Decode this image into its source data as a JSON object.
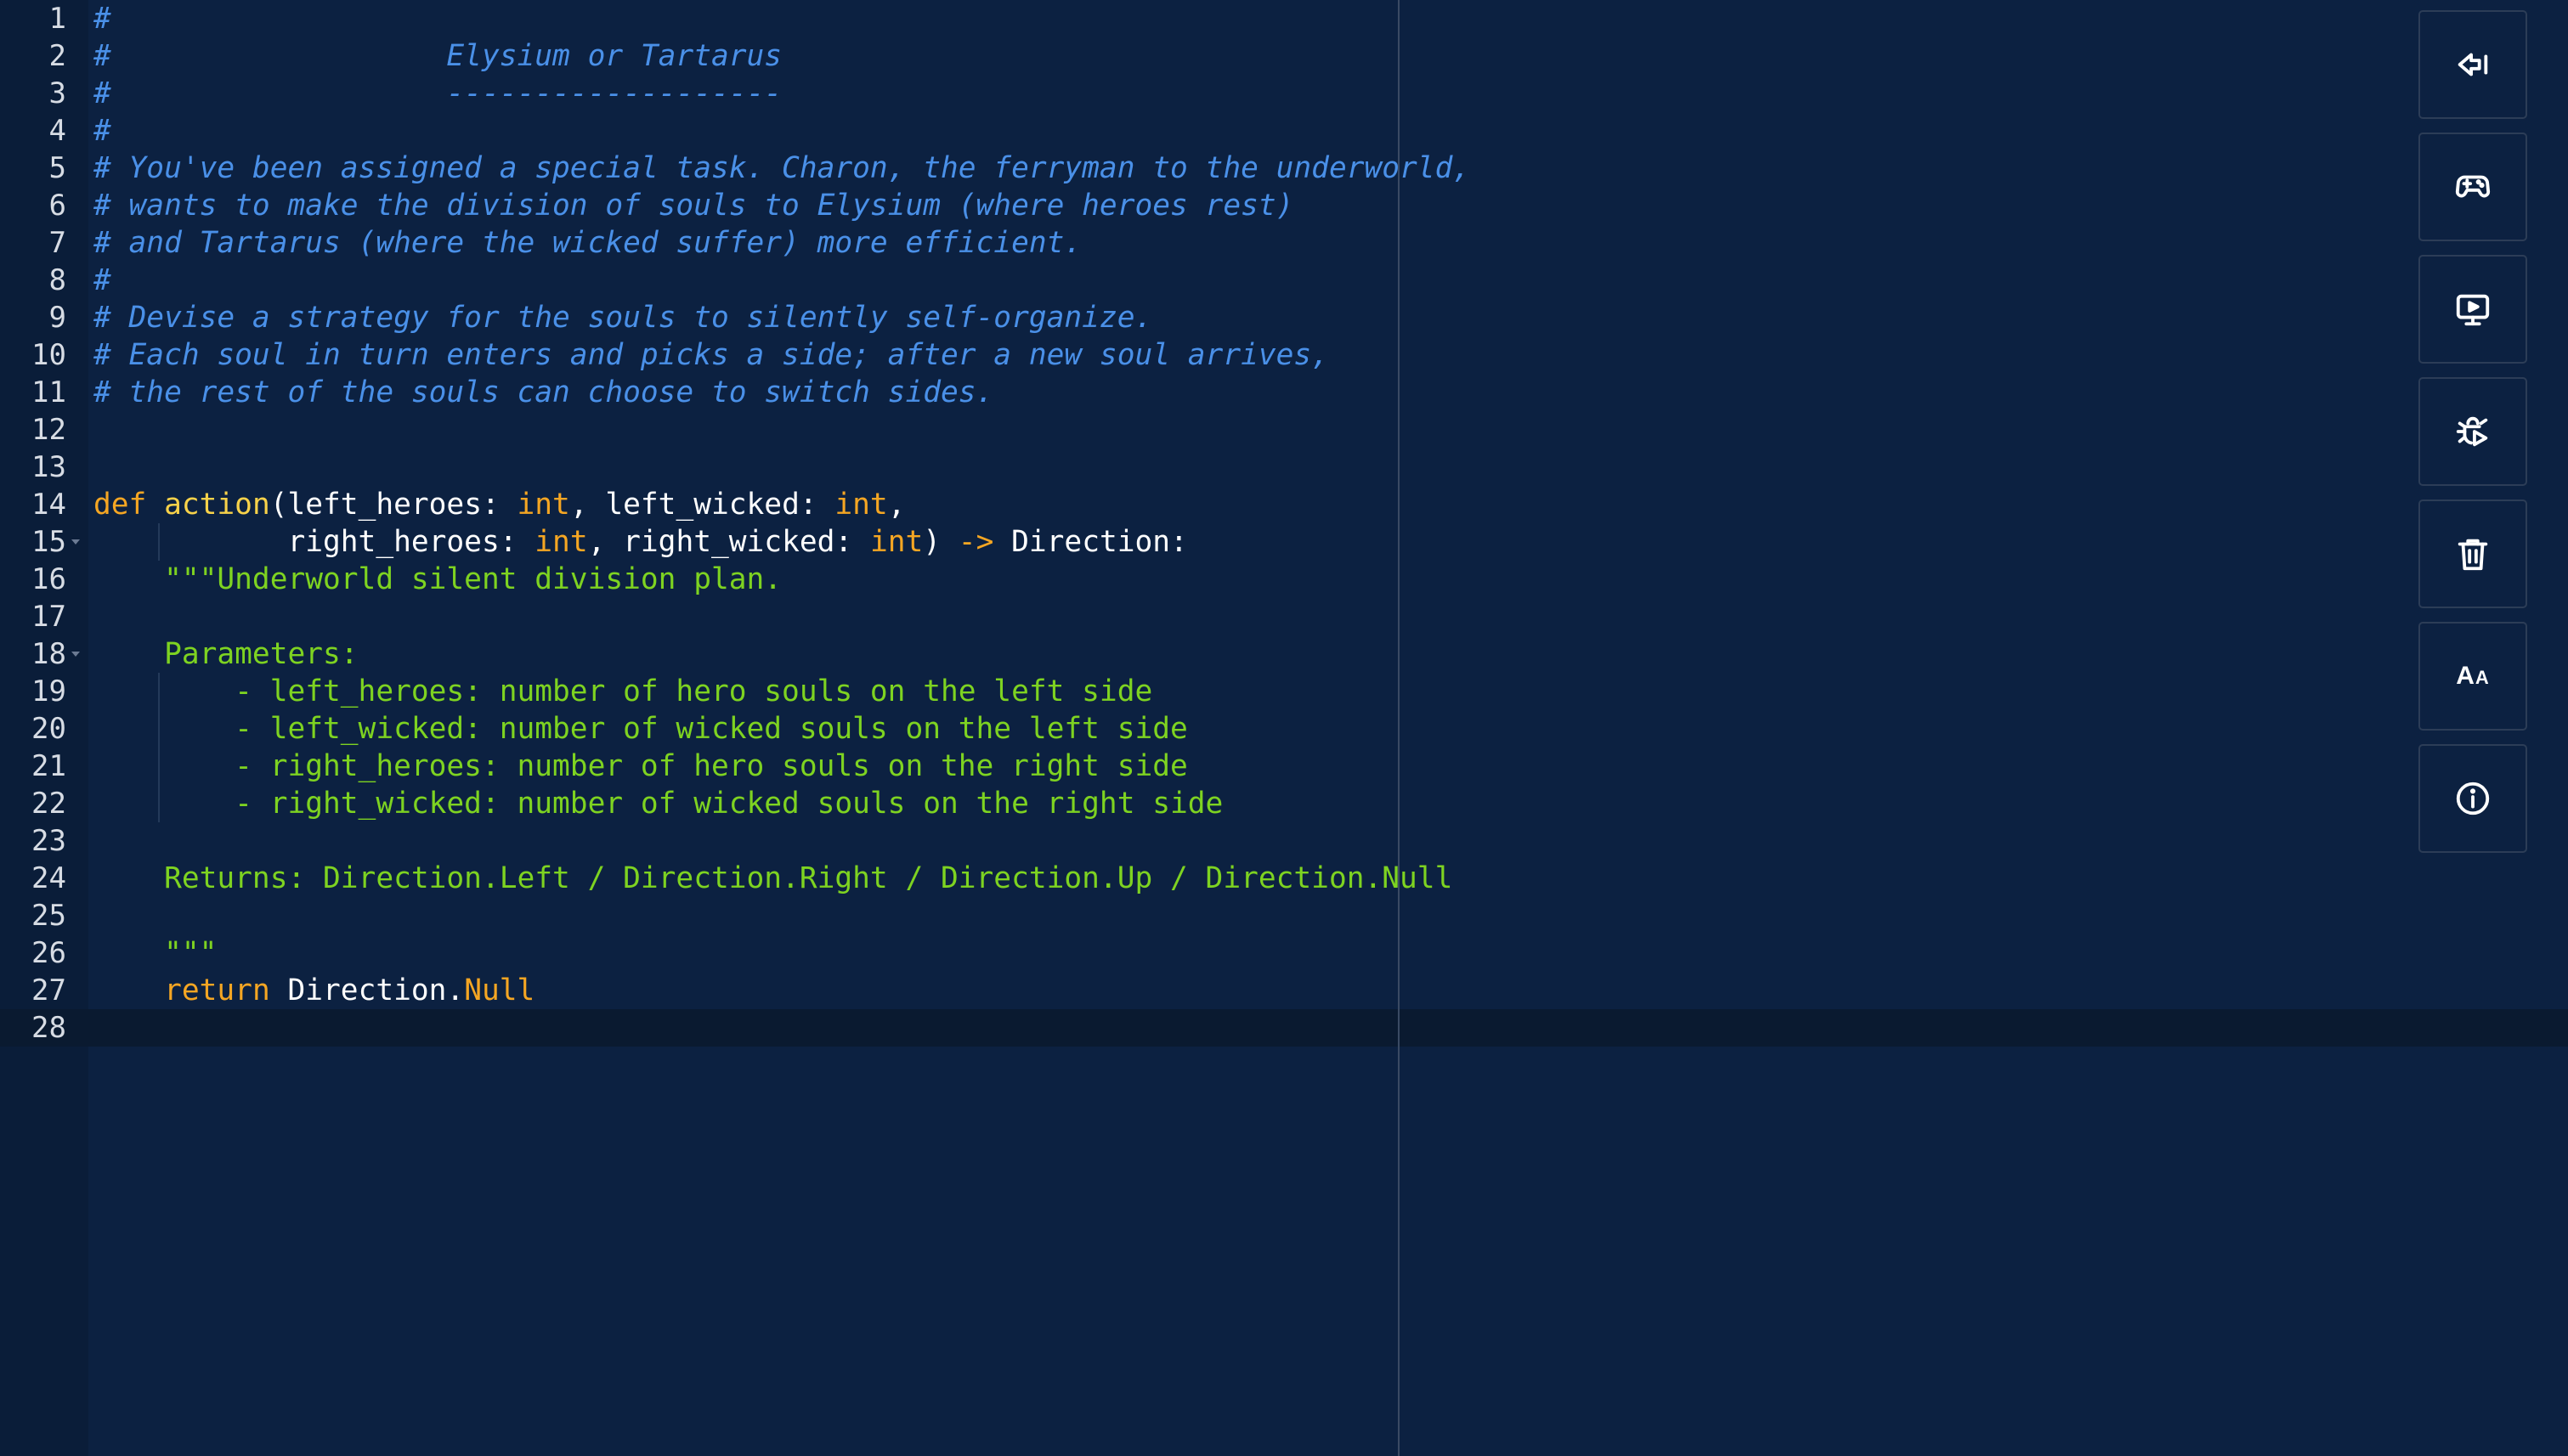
{
  "editor": {
    "lines": [
      {
        "n": "1",
        "tokens": [
          {
            "t": "#",
            "c": "comment"
          }
        ]
      },
      {
        "n": "2",
        "tokens": [
          {
            "t": "#                   Elysium or Tartarus",
            "c": "comment"
          }
        ]
      },
      {
        "n": "3",
        "tokens": [
          {
            "t": "#                   -------------------",
            "c": "comment"
          }
        ]
      },
      {
        "n": "4",
        "tokens": [
          {
            "t": "#",
            "c": "comment"
          }
        ]
      },
      {
        "n": "5",
        "tokens": [
          {
            "t": "# You've been assigned a special task. Charon, the ferryman to the underworld,",
            "c": "comment"
          }
        ]
      },
      {
        "n": "6",
        "tokens": [
          {
            "t": "# wants to make the division of souls to Elysium (where heroes rest)",
            "c": "comment"
          }
        ]
      },
      {
        "n": "7",
        "tokens": [
          {
            "t": "# and Tartarus (where the wicked suffer) more efficient.",
            "c": "comment"
          }
        ]
      },
      {
        "n": "8",
        "tokens": [
          {
            "t": "#",
            "c": "comment"
          }
        ]
      },
      {
        "n": "9",
        "tokens": [
          {
            "t": "# Devise a strategy for the souls to silently self-organize.",
            "c": "comment"
          }
        ]
      },
      {
        "n": "10",
        "tokens": [
          {
            "t": "# Each soul in turn enters and picks a side; after a new soul arrives,",
            "c": "comment"
          }
        ]
      },
      {
        "n": "11",
        "tokens": [
          {
            "t": "# the rest of the souls can choose to switch sides.",
            "c": "comment"
          }
        ]
      },
      {
        "n": "12",
        "tokens": []
      },
      {
        "n": "13",
        "tokens": []
      },
      {
        "n": "14",
        "tokens": [
          {
            "t": "def",
            "c": "kw"
          },
          {
            "t": " ",
            "c": "plain"
          },
          {
            "t": "action",
            "c": "fn"
          },
          {
            "t": "(left_heroes: ",
            "c": "plain"
          },
          {
            "t": "int",
            "c": "ty"
          },
          {
            "t": ", left_wicked: ",
            "c": "plain"
          },
          {
            "t": "int",
            "c": "ty"
          },
          {
            "t": ",",
            "c": "plain"
          }
        ]
      },
      {
        "n": "15",
        "fold": true,
        "tokens": [
          {
            "t": "           right_heroes: ",
            "c": "plain"
          },
          {
            "t": "int",
            "c": "ty"
          },
          {
            "t": ", right_wicked: ",
            "c": "plain"
          },
          {
            "t": "int",
            "c": "ty"
          },
          {
            "t": ") ",
            "c": "plain"
          },
          {
            "t": "->",
            "c": "kw"
          },
          {
            "t": " Direction:",
            "c": "plain"
          }
        ]
      },
      {
        "n": "16",
        "tokens": [
          {
            "t": "    \"\"\"Underworld silent division plan.",
            "c": "str"
          }
        ]
      },
      {
        "n": "17",
        "tokens": []
      },
      {
        "n": "18",
        "fold": true,
        "tokens": [
          {
            "t": "    Parameters:",
            "c": "str"
          }
        ]
      },
      {
        "n": "19",
        "tokens": [
          {
            "t": "        - left_heroes: number of hero souls on the left side",
            "c": "str"
          }
        ]
      },
      {
        "n": "20",
        "tokens": [
          {
            "t": "        - left_wicked: number of wicked souls on the left side",
            "c": "str"
          }
        ]
      },
      {
        "n": "21",
        "tokens": [
          {
            "t": "        - right_heroes: number of hero souls on the right side",
            "c": "str"
          }
        ]
      },
      {
        "n": "22",
        "tokens": [
          {
            "t": "        - right_wicked: number of wicked souls on the right side",
            "c": "str"
          }
        ]
      },
      {
        "n": "23",
        "tokens": []
      },
      {
        "n": "24",
        "tokens": [
          {
            "t": "    Returns: Direction.Left / Direction.Right / Direction.Up / Direction.Null",
            "c": "str"
          }
        ]
      },
      {
        "n": "25",
        "tokens": []
      },
      {
        "n": "26",
        "tokens": [
          {
            "t": "    \"\"\"",
            "c": "str"
          }
        ]
      },
      {
        "n": "27",
        "tokens": [
          {
            "t": "    ",
            "c": "plain"
          },
          {
            "t": "return",
            "c": "kw"
          },
          {
            "t": " Direction.",
            "c": "plain"
          },
          {
            "t": "Null",
            "c": "ty"
          }
        ]
      },
      {
        "n": "28",
        "tokens": []
      }
    ]
  },
  "toolbar": {
    "buttons": [
      {
        "name": "submit-button",
        "icon": "arrow-left-bar-icon"
      },
      {
        "name": "play-game-button",
        "icon": "gamepad-icon"
      },
      {
        "name": "run-simulation-button",
        "icon": "monitor-play-icon"
      },
      {
        "name": "debug-button",
        "icon": "bug-play-icon"
      },
      {
        "name": "reset-code-button",
        "icon": "trash-icon"
      },
      {
        "name": "font-size-button",
        "icon": "font-size-icon",
        "label": "AA"
      },
      {
        "name": "info-button",
        "icon": "info-icon"
      }
    ]
  },
  "colors": {
    "background": "#0c2141",
    "gutter": "#0a1d39",
    "comment": "#4a90e8",
    "keyword": "#f5a623",
    "function": "#f8d24a",
    "string": "#7ed321"
  }
}
